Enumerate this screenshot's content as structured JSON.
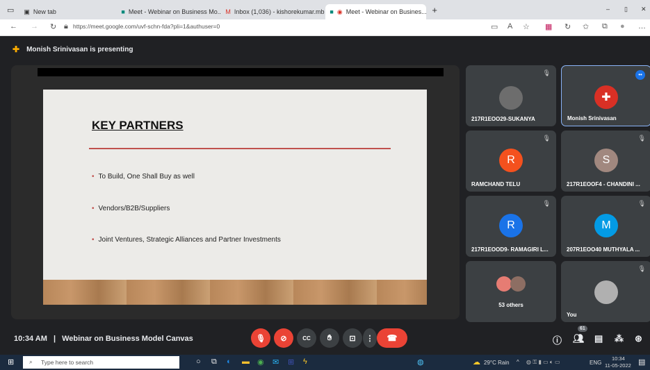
{
  "browser": {
    "tabs": [
      {
        "label": "New tab"
      },
      {
        "label": "Meet - Webinar on Business Mo..."
      },
      {
        "label": "Inbox (1,036) - kishorekumar.mb"
      },
      {
        "label": "Meet - Webinar on Busines..."
      }
    ],
    "url": "https://meet.google.com/uvf-schn-fda?pli=1&authuser=0"
  },
  "presenter": {
    "text": "Monish Srinivasan is presenting"
  },
  "slide": {
    "title": "KEY PARTNERS",
    "bullets": [
      "To Build, One Shall Buy as well",
      "Vendors/B2B/Suppliers",
      "Joint Ventures, Strategic Alliances and Partner Investments"
    ]
  },
  "participants": [
    {
      "name": "217R1EOO29-SUKANYA",
      "avatar": "",
      "color": "#5f6368"
    },
    {
      "name": "Monish Srinivasan",
      "avatar": "",
      "color": "#d93025"
    },
    {
      "name": "RAMCHAND TELU",
      "avatar": "R",
      "color": "#f4511e"
    },
    {
      "name": "217R1EOOF4 - CHANDINI ...",
      "avatar": "S",
      "color": "#a1887f"
    },
    {
      "name": "217R1EOOD9- RAMAGIRI L...",
      "avatar": "R",
      "color": "#1a73e8"
    },
    {
      "name": "207R1EOO40 MUTHYALA ...",
      "avatar": "M",
      "color": "#039be5"
    },
    {
      "name": "53 others",
      "avatar": "",
      "color": "#5f6368"
    },
    {
      "name": "You",
      "avatar": "",
      "color": "#9aa0a6"
    }
  ],
  "meeting": {
    "time": "10:34 AM",
    "separator": "|",
    "title": "Webinar on Business Model Canvas",
    "people_count": "61"
  },
  "taskbar": {
    "search_placeholder": "Type here to search",
    "weather": "29°C Rain",
    "lang": "ENG",
    "clock_time": "10:34",
    "clock_date": "11-05-2022"
  }
}
